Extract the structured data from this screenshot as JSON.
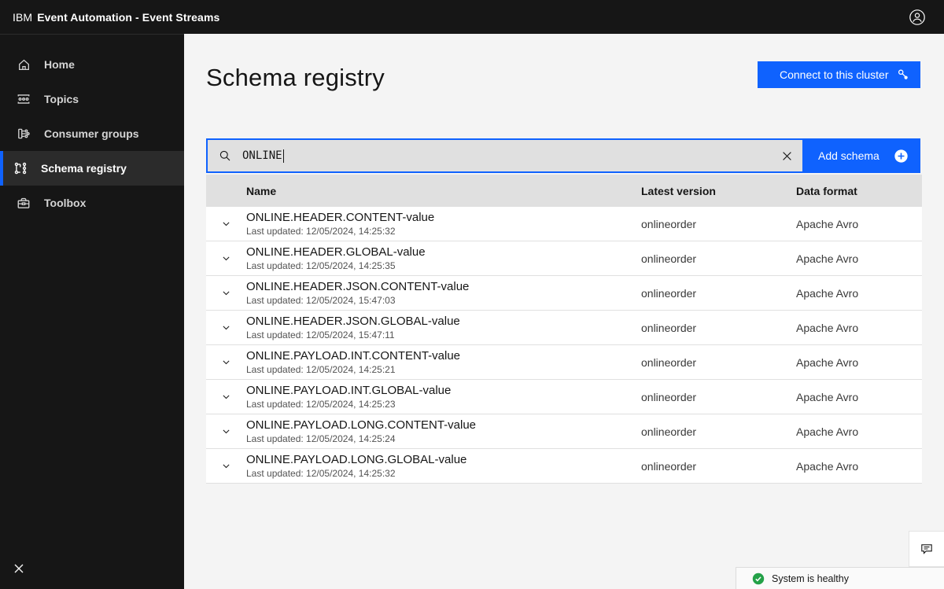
{
  "header": {
    "brand_prefix": "IBM",
    "brand_title": "Event Automation - Event Streams"
  },
  "sidebar": {
    "items": [
      {
        "label": "Home",
        "icon": "home-icon",
        "selected": false
      },
      {
        "label": "Topics",
        "icon": "topics-icon",
        "selected": false
      },
      {
        "label": "Consumer groups",
        "icon": "consumer-groups-icon",
        "selected": false
      },
      {
        "label": "Schema registry",
        "icon": "schema-registry-icon",
        "selected": true
      },
      {
        "label": "Toolbox",
        "icon": "toolbox-icon",
        "selected": false
      }
    ]
  },
  "page": {
    "title": "Schema registry",
    "connect_button_label": "Connect to this cluster"
  },
  "search": {
    "value": "ONLINE",
    "icon": "search-icon",
    "clear_icon": "close-icon"
  },
  "add_button": {
    "label": "Add schema",
    "icon": "add-filled-icon"
  },
  "table": {
    "columns": [
      "Name",
      "Latest version",
      "Data format"
    ],
    "rows": [
      {
        "name": "ONLINE.HEADER.CONTENT-value",
        "last_updated": "Last updated: 12/05/2024, 14:25:32",
        "latest_version": "onlineorder",
        "data_format": "Apache Avro"
      },
      {
        "name": "ONLINE.HEADER.GLOBAL-value",
        "last_updated": "Last updated: 12/05/2024, 14:25:35",
        "latest_version": "onlineorder",
        "data_format": "Apache Avro"
      },
      {
        "name": "ONLINE.HEADER.JSON.CONTENT-value",
        "last_updated": "Last updated: 12/05/2024, 15:47:03",
        "latest_version": "onlineorder",
        "data_format": "Apache Avro"
      },
      {
        "name": "ONLINE.HEADER.JSON.GLOBAL-value",
        "last_updated": "Last updated: 12/05/2024, 15:47:11",
        "latest_version": "onlineorder",
        "data_format": "Apache Avro"
      },
      {
        "name": "ONLINE.PAYLOAD.INT.CONTENT-value",
        "last_updated": "Last updated: 12/05/2024, 14:25:21",
        "latest_version": "onlineorder",
        "data_format": "Apache Avro"
      },
      {
        "name": "ONLINE.PAYLOAD.INT.GLOBAL-value",
        "last_updated": "Last updated: 12/05/2024, 14:25:23",
        "latest_version": "onlineorder",
        "data_format": "Apache Avro"
      },
      {
        "name": "ONLINE.PAYLOAD.LONG.CONTENT-value",
        "last_updated": "Last updated: 12/05/2024, 14:25:24",
        "latest_version": "onlineorder",
        "data_format": "Apache Avro"
      },
      {
        "name": "ONLINE.PAYLOAD.LONG.GLOBAL-value",
        "last_updated": "Last updated: 12/05/2024, 14:25:32",
        "latest_version": "onlineorder",
        "data_format": "Apache Avro"
      }
    ]
  },
  "status_bar": {
    "label": "System is healthy",
    "icon": "checkmark-filled-icon"
  },
  "colors": {
    "accent_blue": "#0f62fe",
    "dark_shell": "#161616",
    "selected_nav_bg": "#2b2b2b",
    "main_bg": "#f4f4f4",
    "field_gray": "#e0e0e0",
    "healthy_green": "#24a148"
  }
}
